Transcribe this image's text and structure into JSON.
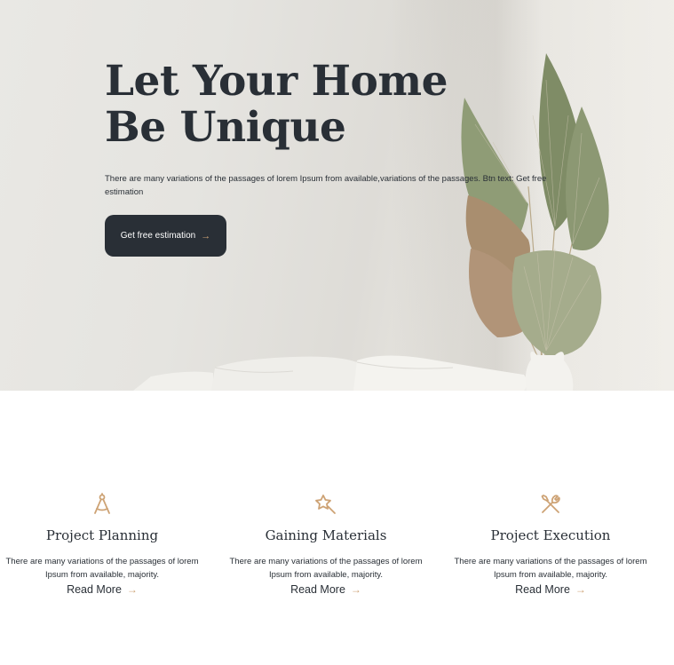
{
  "hero": {
    "title": "Let Your Home Be Unique",
    "description": "There are many variations of the passages of lorem Ipsum from available,variations of the passages. Btn text: Get free estimation",
    "cta_label": "Get free estimation",
    "cta_arrow": "→"
  },
  "services": [
    {
      "icon": "drafting-compass-icon",
      "title": "Project Planning",
      "description": "There are many variations of the passages of lorem Ipsum from available, majority.",
      "link_label": "Read More",
      "link_arrow": "→"
    },
    {
      "icon": "magic-wand-star-icon",
      "title": "Gaining Materials",
      "description": "There are many variations of the passages of lorem Ipsum from available, majority.",
      "link_label": "Read More",
      "link_arrow": "→"
    },
    {
      "icon": "crossed-tools-icon",
      "title": "Project Execution",
      "description": "There are many variations of the passages of lorem Ipsum from available, majority.",
      "link_label": "Read More",
      "link_arrow": "→"
    }
  ],
  "colors": {
    "primary": "#292f36",
    "accent": "#cda274",
    "background": "#ffffff",
    "hero_wall": "#e6e5e1"
  }
}
